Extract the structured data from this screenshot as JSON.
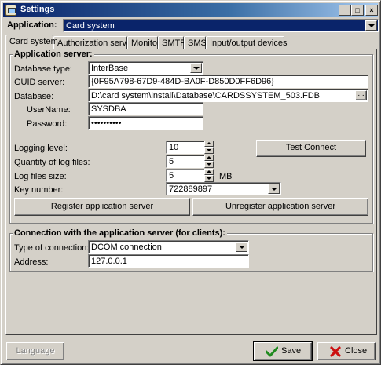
{
  "window": {
    "title": "Settings"
  },
  "application": {
    "label": "Application:",
    "value": "Card system"
  },
  "tabs": [
    {
      "label": "Card system"
    },
    {
      "label": "Authorization server"
    },
    {
      "label": "Monitor"
    },
    {
      "label": "SMTP"
    },
    {
      "label": "SMS"
    },
    {
      "label": "Input/output devices"
    }
  ],
  "app_server": {
    "title": "Application server:",
    "db_type_label": "Database type:",
    "db_type_value": "InterBase",
    "guid_label": "GUID server:",
    "guid_value": "{0F95A798-67D9-484D-BA0F-D850D0FF6D96}",
    "database_label": "Database:",
    "database_value": "D:\\card system\\install\\Database\\CARDSSYSTEM_503.FDB",
    "browse_label": "...",
    "username_label": "UserName:",
    "username_value": "SYSDBA",
    "password_label": "Password:",
    "password_value": "••••••••••",
    "logging_label": "Logging level:",
    "logging_value": "10",
    "log_qty_label": "Quantity of log files:",
    "log_qty_value": "5",
    "log_size_label": "Log files size:",
    "log_size_value": "5",
    "log_size_unit": "MB",
    "key_label": "Key number:",
    "key_value": "722889897",
    "test_connect": "Test Connect",
    "register": "Register application server",
    "unregister": "Unregister application server"
  },
  "client_conn": {
    "title": "Connection with the application server (for clients):",
    "type_label": "Type of connection:",
    "type_value": "DCOM connection",
    "address_label": "Address:",
    "address_value": "127.0.0.1"
  },
  "footer": {
    "language": "Language",
    "save": "Save",
    "close": "Close"
  }
}
